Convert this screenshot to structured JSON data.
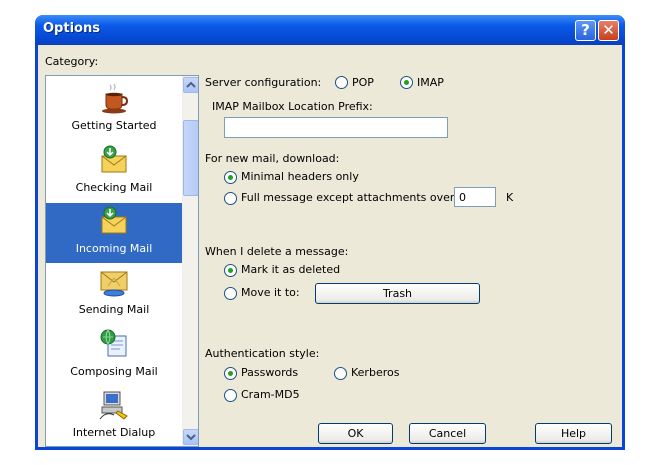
{
  "window": {
    "title": "Options"
  },
  "titlebar": {
    "help_glyph": "?",
    "close_glyph": "✕"
  },
  "category": {
    "label": "Category:",
    "items": [
      {
        "label": "Getting Started",
        "icon": "coffee-cup-icon",
        "selected": false
      },
      {
        "label": "Checking Mail",
        "icon": "check-mail-icon",
        "selected": false
      },
      {
        "label": "Incoming Mail",
        "icon": "incoming-mail-icon",
        "selected": true
      },
      {
        "label": "Sending Mail",
        "icon": "sending-mail-icon",
        "selected": false
      },
      {
        "label": "Composing Mail",
        "icon": "composing-mail-icon",
        "selected": false
      },
      {
        "label": "Internet Dialup",
        "icon": "internet-dialup-icon",
        "selected": false
      }
    ]
  },
  "server": {
    "label": "Server configuration:",
    "options": [
      {
        "label": "POP",
        "checked": false
      },
      {
        "label": "IMAP",
        "checked": true
      }
    ]
  },
  "imap_prefix": {
    "label": "IMAP Mailbox Location Prefix:",
    "value": ""
  },
  "new_mail": {
    "label": "For new mail, download:",
    "option_minimal": "Minimal headers only",
    "option_full": "Full message except attachments over",
    "minimal_checked": true,
    "full_checked": false,
    "size_value": "0",
    "size_unit": "K"
  },
  "delete": {
    "label": "When I delete a message:",
    "option_mark": "Mark it as deleted",
    "option_move": "Move it to:",
    "mark_checked": true,
    "move_checked": false,
    "folder": "Trash"
  },
  "auth": {
    "label": "Authentication style:",
    "option_passwords": "Passwords",
    "option_kerberos": "Kerberos",
    "option_crammd5": "Cram-MD5",
    "selected": "Passwords"
  },
  "buttons": {
    "ok": "OK",
    "cancel": "Cancel",
    "help": "Help"
  },
  "colors": {
    "title_bar": "#0a5ae8",
    "selection": "#316ac5",
    "dialog_face": "#ece9d8",
    "radio_dot": "#21a121"
  }
}
